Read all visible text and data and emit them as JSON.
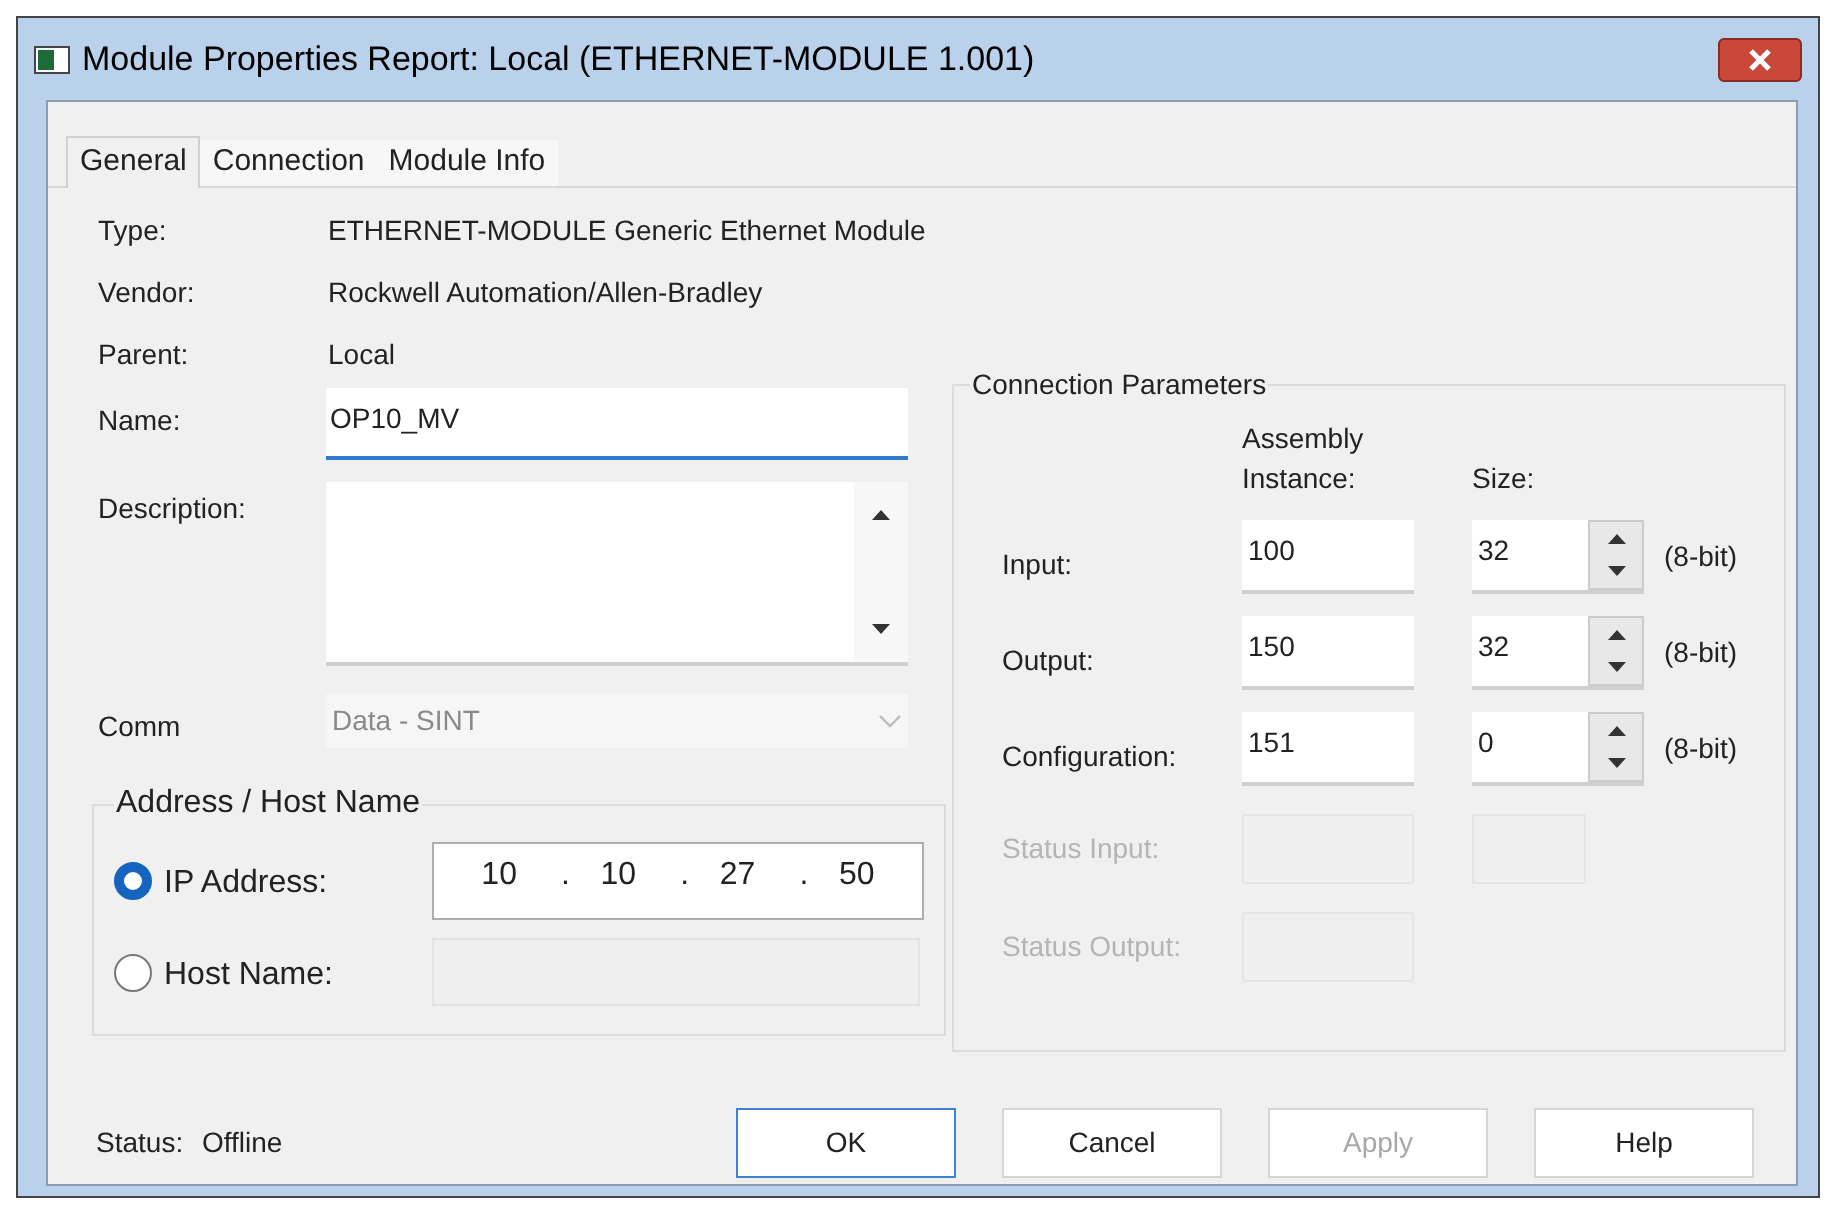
{
  "window": {
    "title": "Module Properties Report: Local (ETHERNET-MODULE 1.001)"
  },
  "tabs": [
    {
      "label": "General",
      "selected": true
    },
    {
      "label": "Connection",
      "selected": false
    },
    {
      "label": "Module Info",
      "selected": false
    }
  ],
  "info": [
    {
      "label": "Type:",
      "value": "ETHERNET-MODULE Generic Ethernet Module"
    },
    {
      "label": "Vendor:",
      "value": "Rockwell Automation/Allen-Bradley"
    },
    {
      "label": "Parent:",
      "value": "Local"
    }
  ],
  "name": {
    "label": "Name:",
    "value": "OP10_MV",
    "focused": true
  },
  "description": {
    "label": "Description:"
  },
  "comm": {
    "label": "Comm",
    "value": "Data - SINT",
    "disabled": true
  },
  "address": {
    "title": "Address / Host Name",
    "options": [
      {
        "label": "IP Address:",
        "selected": true,
        "octets": [
          "10",
          "10",
          "27",
          "50"
        ],
        "separator": "."
      },
      {
        "label": "Host Name:",
        "selected": false
      }
    ]
  },
  "connection_parameters": {
    "title": "Connection Parameters",
    "instance_header": "Assembly Instance:",
    "size_header": "Size:",
    "rows": [
      {
        "kind": "active",
        "label": "Input:",
        "instance": "100",
        "size": "32",
        "unit": "(8-bit)"
      },
      {
        "kind": "active",
        "label": "Output:",
        "instance": "150",
        "size": "32",
        "unit": "(8-bit)"
      },
      {
        "kind": "active",
        "label": "Configuration:",
        "instance": "151",
        "size": "0",
        "unit": "(8-bit)"
      },
      {
        "kind": "disabled_pair",
        "label": "Status Input:"
      },
      {
        "kind": "disabled_single",
        "label": "Status Output:"
      }
    ]
  },
  "status": {
    "label": "Status:",
    "value": "Offline"
  },
  "buttons": [
    {
      "label": "OK",
      "default": true,
      "disabled": false
    },
    {
      "label": "Cancel",
      "default": false,
      "disabled": false
    },
    {
      "label": "Apply",
      "default": false,
      "disabled": true
    },
    {
      "label": "Help",
      "default": false,
      "disabled": false
    }
  ]
}
